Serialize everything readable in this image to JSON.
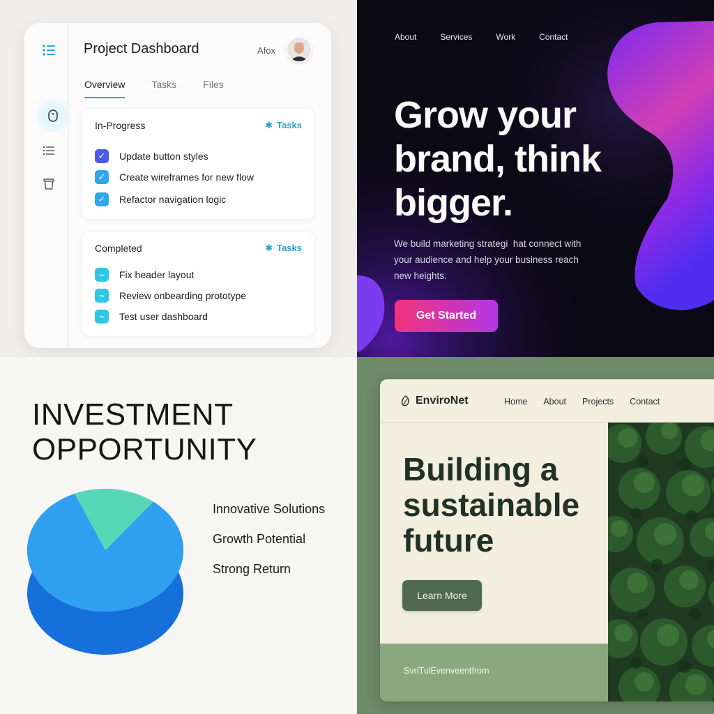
{
  "dashboard": {
    "title": "Project Dashboard",
    "user": "Afox",
    "tabs": [
      {
        "label": "Overview",
        "active": true
      },
      {
        "label": "Tasks",
        "active": false
      },
      {
        "label": "Files",
        "active": false
      }
    ],
    "sidebar_icons": [
      "list-icon",
      "mouse-icon",
      "menu-icon",
      "trash-icon"
    ],
    "in_progress": {
      "heading": "In-Progress",
      "link": "Tasks",
      "tasks": [
        "Update button styles",
        "Create wireframes for new flow",
        "Refactor navigation logic"
      ]
    },
    "completed": {
      "heading": "Completed",
      "link": "Tasks",
      "tasks": [
        "Fix header layout",
        "Review onbearding prototype",
        "Test user dashboard"
      ]
    },
    "accent": "#2aa8d4"
  },
  "agency": {
    "nav": [
      "About",
      "Services",
      "Work",
      "Contact"
    ],
    "headline": "Grow your brand, think bigger.",
    "body": "We build marketing strategi  hat connect with your audience and help your business reach new heights.",
    "cta": "Get Started",
    "colors": {
      "background": "#0a0914",
      "cta_start": "#f1337a",
      "cta_end": "#b336e6"
    }
  },
  "investment": {
    "title_line1": "INVESTMENT",
    "title_line2": "OPPORTUNITY",
    "items": [
      "Innovative Solutions",
      "Growth Potential",
      "Strong Return"
    ],
    "colors": {
      "blue": "#2f9ff0",
      "teal": "#58d6b8"
    }
  },
  "chart_data": {
    "type": "pie",
    "title": "",
    "slices": [
      {
        "label": "",
        "value": 83,
        "color": "#2f9ff0"
      },
      {
        "label": "",
        "value": 17,
        "color": "#58d6b8"
      }
    ],
    "legend": "none"
  },
  "environet": {
    "brand": "EnviroNet",
    "nav": [
      "Home",
      "About",
      "Projects",
      "Contact"
    ],
    "headline_line1": "Building a",
    "headline_line2": "sustainable",
    "headline_line3": "future",
    "cta": "Learn More",
    "footer": "SvriTulEvenveentfrom",
    "colors": {
      "primary": "#4f6a50",
      "cream": "#f3efde",
      "sage": "#8aa87f"
    }
  }
}
